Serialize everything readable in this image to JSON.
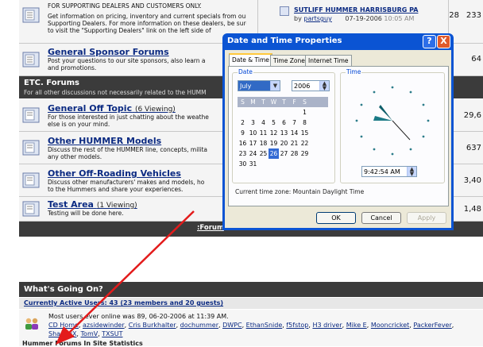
{
  "forum": {
    "top_row": {
      "desc_lines": [
        "FOR SUPPORTING DEALERS AND CUSTOMERS ONLY.",
        "Get information on pricing, inventory and current specials from our",
        "Supporting Dealers. For more information on these dealers, be sure",
        "to visit the \"Supporting Dealers\" link on the left side of"
      ],
      "last_post_title": "SUTLIFF HUMMER HARRISBURG PA",
      "last_post_by": "by",
      "last_post_user": "partsguy",
      "last_post_date": "07-19-2006",
      "last_post_time": "10:05 AM",
      "threads": "28",
      "posts": "233"
    },
    "sponsor": {
      "title": "General Sponsor Forums",
      "desc_lines": [
        "Post your questions to our site sponsors, also learn a",
        "and promotions."
      ],
      "posts": "64"
    },
    "section": {
      "title": "ETC. Forums",
      "desc": "For all other discussions not necessarily related to the HUMM"
    },
    "rows": [
      {
        "title": "General Off Topic",
        "viewing": "(6 Viewing)",
        "desc_lines": [
          "For those interested in just chatting about the weathe",
          "else is on your mind."
        ],
        "num": "29,6"
      },
      {
        "title": "Other HUMMER Models",
        "viewing": "",
        "desc_lines": [
          "Discuss the rest of the HUMMER line, concepts, milita",
          "any other models."
        ],
        "num": "637"
      },
      {
        "title": "Other Off-Roading Vehicles",
        "viewing": "",
        "desc_lines": [
          "Discuss other manufacturers' makes and models, ho",
          "to the Hummers and share your experiences."
        ],
        "num": "3,40"
      },
      {
        "title": "Test Area",
        "viewing": "(1 Viewing)",
        "desc_lines": [
          "Testing will be done here."
        ],
        "num": "1,48"
      }
    ],
    "footer_link": ":Forum"
  },
  "going_on": {
    "title": "What's Going On?",
    "active_users": "Currently Active Users: 43 (23 members and 20 guests)",
    "most_users": "Most users ever online was 89, 06-20-2006 at 11:39 AM.",
    "users_line1": [
      "CD Home",
      "azsidewinder",
      "Cris Burkhalter",
      "dochummer",
      "DWPC",
      "EthanSnide",
      "f5fstop",
      "H3 driver",
      "Mike E",
      "Mooncricket",
      "PackerFever"
    ],
    "users_line2": [
      "ShaggyX",
      "TomV",
      "TXSUT"
    ],
    "cut_line": "Hummer Forums In Site Statistics"
  },
  "dialog": {
    "title": "Date and Time Properties",
    "help_label": "?",
    "close_label": "X",
    "tabs": [
      "Date & Time",
      "Time Zone",
      "Internet Time"
    ],
    "date_group": "Date",
    "time_group": "Time",
    "month": "July",
    "year": "2006",
    "weekdays": [
      "S",
      "M",
      "T",
      "W",
      "T",
      "F",
      "S"
    ],
    "weeks": [
      [
        "",
        "",
        "",
        "",
        "",
        "",
        "1"
      ],
      [
        "2",
        "3",
        "4",
        "5",
        "6",
        "7",
        "8"
      ],
      [
        "9",
        "10",
        "11",
        "12",
        "13",
        "14",
        "15"
      ],
      [
        "16",
        "17",
        "18",
        "19",
        "20",
        "21",
        "22"
      ],
      [
        "23",
        "24",
        "25",
        "26",
        "27",
        "28",
        "29"
      ],
      [
        "30",
        "31",
        "",
        "",
        "",
        "",
        ""
      ]
    ],
    "selected_day": "26",
    "time": "9:42:54 AM",
    "timezone": "Current time zone: Mountain Daylight Time",
    "ok": "OK",
    "cancel": "Cancel",
    "apply": "Apply"
  },
  "colors": {
    "forum_link": "#0b2a82",
    "section_bar": "#3b3b3b",
    "dialog_title": "#0b54d3",
    "arrow": "#e31b1b"
  }
}
